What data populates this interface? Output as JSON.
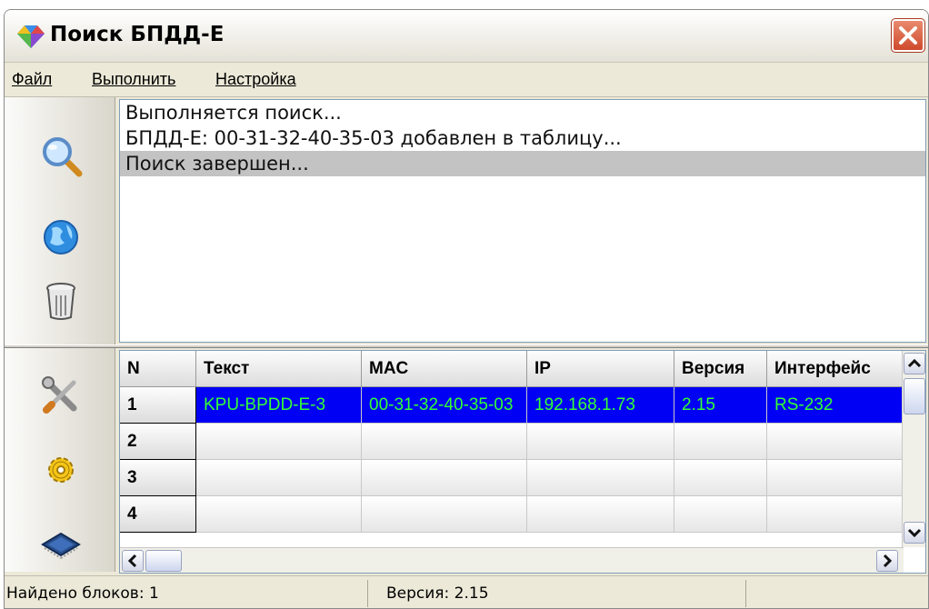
{
  "window": {
    "title": "Поиск БПДД-Е",
    "icon": "app-diamond-icon",
    "close_icon": "close-icon"
  },
  "menu": {
    "items": [
      "Файл",
      "Выполнить",
      "Настройка"
    ]
  },
  "toolbar_top": {
    "icons": [
      "search-icon",
      "network-globe-icon",
      "trash-icon"
    ]
  },
  "toolbar_bottom": {
    "icons": [
      "tools-icon",
      "settings-gear-icon",
      "chip-icon"
    ]
  },
  "log": {
    "lines": [
      "Выполняется поиск...",
      "БПДД-Е: 00-31-32-40-35-03 добавлен в таблицу...",
      "Поиск завершен..."
    ],
    "selected_index": 2
  },
  "table": {
    "columns": [
      "N",
      "Текст",
      "MAC",
      "IP",
      "Версия",
      "Интерфейс"
    ],
    "rows": [
      [
        "1",
        "KPU-BPDD-E-3",
        "00-31-32-40-35-03",
        "192.168.1.73",
        "2.15",
        "RS-232"
      ],
      [
        "2",
        "",
        "",
        "",
        "",
        ""
      ],
      [
        "3",
        "",
        "",
        "",
        "",
        ""
      ],
      [
        "4",
        "",
        "",
        "",
        "",
        ""
      ]
    ],
    "selected_row": 0,
    "colors": {
      "selection_bg": "#0000f4",
      "selection_text": "#33ff33"
    }
  },
  "status": {
    "found": "Найдено  блоков: 1",
    "version": "Версия: 2.15"
  }
}
